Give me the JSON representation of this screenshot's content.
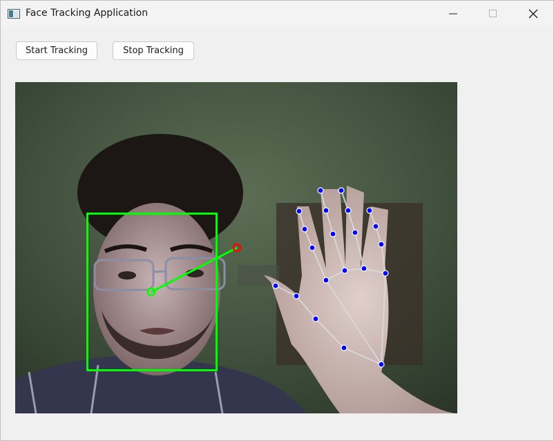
{
  "window": {
    "title": "Face Tracking Application"
  },
  "toolbar": {
    "start_label": "Start Tracking",
    "stop_label": "Stop Tracking"
  },
  "video": {
    "icon": "camera-feed",
    "face_box_color": "#00ff00",
    "hand_landmark_color": "#0000ff",
    "hand_connection_color": "#dcdcdc",
    "target_point_color": "#ff0000"
  }
}
